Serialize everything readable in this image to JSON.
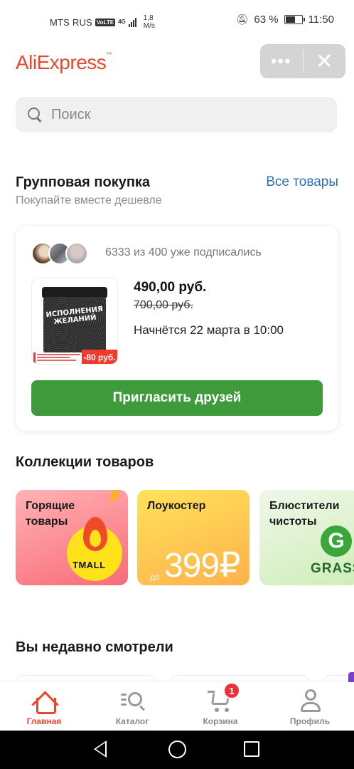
{
  "status_bar": {
    "carrier": "MTS RUS",
    "volte": "VoLTE",
    "network": "4G",
    "speed_value": "1,8",
    "speed_unit": "M/s",
    "battery": "63 %",
    "battery_level": 0.63,
    "time": "11:50"
  },
  "header": {
    "logo": "AliExpress",
    "more_icon": "more-dots-icon",
    "close_icon": "close-icon"
  },
  "search": {
    "placeholder": "Поиск"
  },
  "group_buy": {
    "title": "Групповая покупка",
    "all_link": "Все товары",
    "subtitle": "Покупайте вместе дешевле",
    "subscribed": "6333 из 400 уже подписались",
    "price": "490,00 руб.",
    "old_price": "700,00 руб.",
    "starts": "Начнётся 22 марта в 10:00",
    "discount": "-80 руб.",
    "product_label": "ИСПОЛНЕНИЯ ЖЕЛАНИЙ",
    "invite_button": "Пригласить друзей"
  },
  "collections": {
    "title": "Коллекции товаров",
    "items": [
      {
        "label": "Горящие\nтовары",
        "badge": "TMALL"
      },
      {
        "label": "Лоукостер",
        "prefix": "до",
        "price": "399₽"
      },
      {
        "label": "Блюстители\nчистоты",
        "brand": "GRASS",
        "brand_letter": "G"
      }
    ]
  },
  "recent": {
    "title": "Вы недавно смотрели"
  },
  "tabbar": {
    "tabs": [
      {
        "label": "Главная",
        "icon": "home-icon",
        "active": true
      },
      {
        "label": "Каталог",
        "icon": "catalog-icon"
      },
      {
        "label": "Корзина",
        "icon": "cart-icon",
        "badge": "1"
      },
      {
        "label": "Профиль",
        "icon": "profile-icon"
      }
    ]
  },
  "colors": {
    "brand": "#e8472b",
    "green_button": "#3f9a3c",
    "link": "#2f6fb0"
  }
}
